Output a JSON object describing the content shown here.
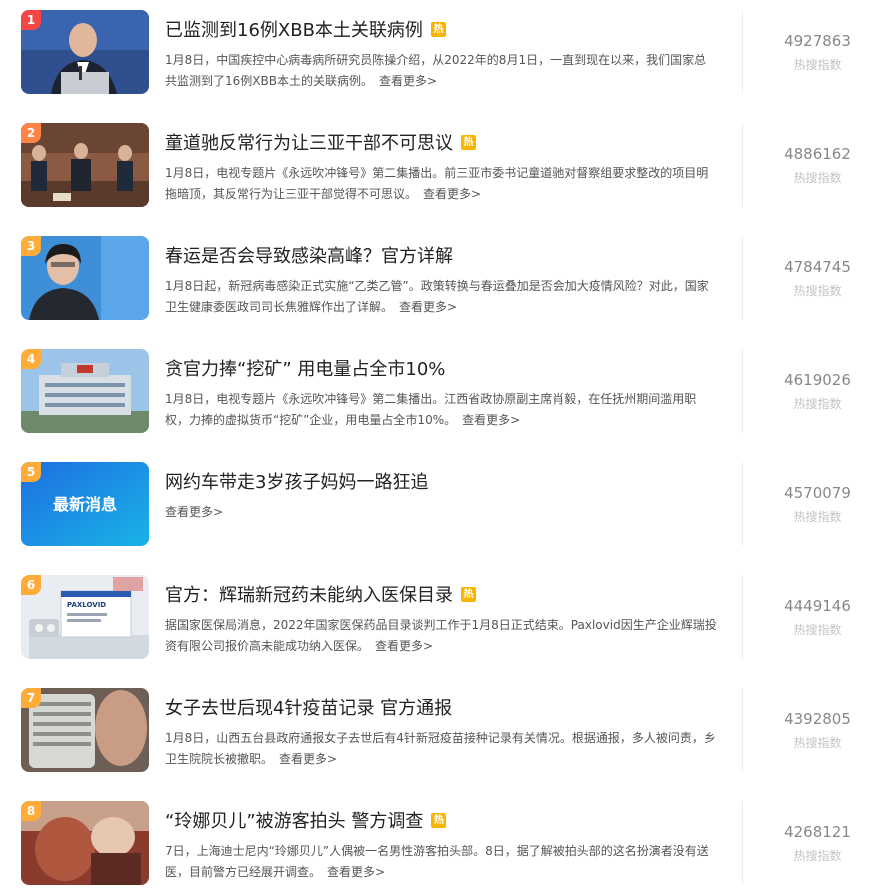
{
  "news_list": [
    {
      "rank": "1",
      "title": "已监测到16例XBB本土关联病例",
      "hot": "热",
      "desc": "1月8日，中国疾控中心病毒病所研究员陈操介绍，从2022年的8月1日，一直到现在以来，我们国家总共监测到了16例XBB本土的关联病例。",
      "more": "查看更多>",
      "count": "4927863",
      "count_label": "热搜指数"
    },
    {
      "rank": "2",
      "title": "童道驰反常行为让三亚干部不可思议",
      "hot": "热",
      "desc": "1月8日，电视专题片《永远吹冲锋号》第二集播出。前三亚市委书记童道驰对督察组要求整改的项目明拖暗顶，其反常行为让三亚干部觉得不可思议。",
      "more": "查看更多>",
      "count": "4886162",
      "count_label": "热搜指数"
    },
    {
      "rank": "3",
      "title": "春运是否会导致感染高峰？官方详解",
      "hot": "",
      "desc": "1月8日起，新冠病毒感染正式实施“乙类乙管”。政策转换与春运叠加是否会加大疫情风险？对此，国家卫生健康委医政司司长焦雅辉作出了详解。",
      "more": "查看更多>",
      "count": "4784745",
      "count_label": "热搜指数"
    },
    {
      "rank": "4",
      "title": "贪官力捧“挖矿” 用电量占全市10%",
      "hot": "",
      "desc": "1月8日，电视专题片《永远吹冲锋号》第二集播出。江西省政协原副主席肖毅，在任抚州期间滥用职权，力捧的虚拟货币“挖矿”企业，用电量占全市10%。",
      "more": "查看更多>",
      "count": "4619026",
      "count_label": "热搜指数"
    },
    {
      "rank": "5",
      "title": "网约车带走3岁孩子妈妈一路狂追",
      "hot": "",
      "desc": "",
      "more": "查看更多>",
      "count": "4570079",
      "count_label": "热搜指数",
      "thumb_text": "最新消息"
    },
    {
      "rank": "6",
      "title": "官方：辉瑞新冠药未能纳入医保目录",
      "hot": "热",
      "desc": "据国家医保局消息，2022年国家医保药品目录谈判工作于1月8日正式结束。Paxlovid因生产企业辉瑞投资有限公司报价高未能成功纳入医保。",
      "more": "查看更多>",
      "count": "4449146",
      "count_label": "热搜指数",
      "thumb_text": "PAXLOVID"
    },
    {
      "rank": "7",
      "title": "女子去世后现4针疫苗记录 官方通报",
      "hot": "",
      "desc": "1月8日，山西五台县政府通报女子去世后有4针新冠疫苗接种记录有关情况。根据通报，多人被问责，乡卫生院院长被撤职。",
      "more": "查看更多>",
      "count": "4392805",
      "count_label": "热搜指数"
    },
    {
      "rank": "8",
      "title": "“玲娜贝儿”被游客拍头 警方调查",
      "hot": "热",
      "desc": "7日，上海迪士尼内“玲娜贝儿”人偶被一名男性游客拍头部。8日，据了解被拍头部的这名扮演者没有送医，目前警方已经展开调查。",
      "more": "查看更多>",
      "count": "4268121",
      "count_label": "热搜指数"
    }
  ],
  "colors": {
    "rank_top": "#f54545",
    "rank_second": "#ff8547",
    "rank_other": "#ffac38",
    "hot_badge": "#f7b500"
  }
}
